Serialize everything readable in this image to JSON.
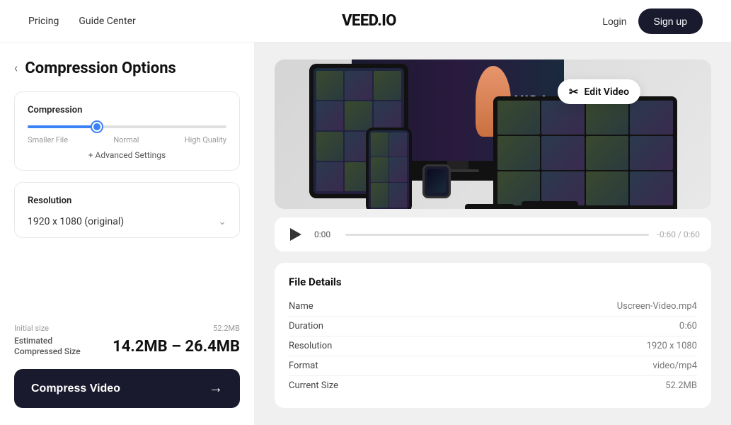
{
  "nav": {
    "pricing_label": "Pricing",
    "guide_label": "Guide Center",
    "logo": "VEED.IO",
    "login_label": "Login",
    "signup_label": "Sign up"
  },
  "left": {
    "back_label": "‹",
    "title": "Compression Options",
    "compression_card": {
      "label": "Compression",
      "slider_fill_pct": "35%",
      "labels": {
        "small": "Smaller File",
        "normal": "Normal",
        "quality": "High Quality"
      },
      "advanced_label": "+ Advanced Settings"
    },
    "resolution_card": {
      "label": "Resolution",
      "value": "1920 x 1080 (original)"
    },
    "initial_size_label": "Initial size",
    "initial_size_value": "52.2MB",
    "compressed_label_line1": "Estimated",
    "compressed_label_line2": "Compressed Size",
    "compressed_value": "14.2MB – 26.4MB",
    "compress_btn_label": "Compress Video",
    "compress_btn_arrow": "→"
  },
  "right": {
    "edit_video_label": "Edit Video",
    "video_time_current": "0:00",
    "video_time_end": "-0:60 / 0:60",
    "file_details": {
      "title": "File Details",
      "rows": [
        {
          "key": "Name",
          "value": "Uscreen-Video.mp4"
        },
        {
          "key": "Duration",
          "value": "0:60"
        },
        {
          "key": "Resolution",
          "value": "1920 x 1080"
        },
        {
          "key": "Format",
          "value": "video/mp4"
        },
        {
          "key": "Current Size",
          "value": "52.2MB"
        }
      ]
    }
  }
}
